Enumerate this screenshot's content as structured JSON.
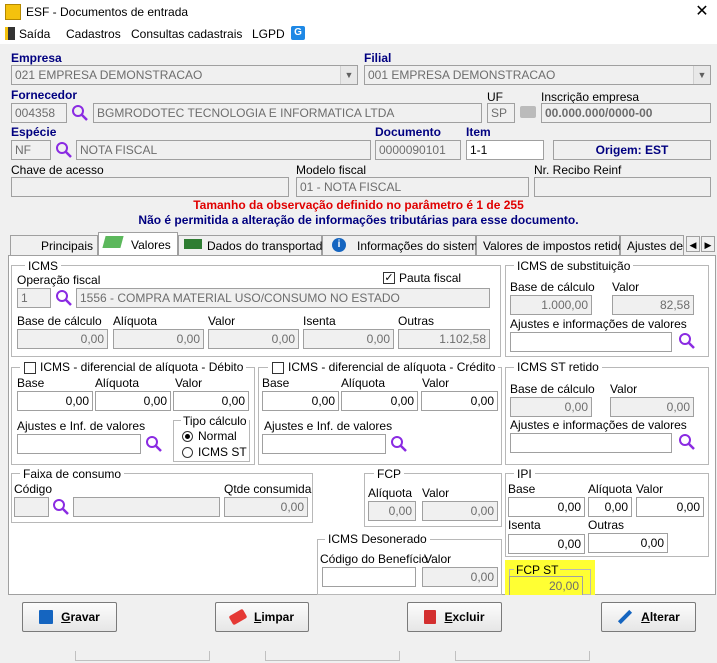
{
  "window": {
    "title": "ESF - Documentos de entrada",
    "close": "✕"
  },
  "menu": [
    "Saída",
    "Cadastros",
    "Consultas cadastrais",
    "LGPD"
  ],
  "header": {
    "empresa_label": "Empresa",
    "empresa_value": "021 EMPRESA DEMONSTRACAO",
    "filial_label": "Filial",
    "filial_value": "001 EMPRESA DEMONSTRACAO",
    "fornecedor_label": "Fornecedor",
    "fornecedor_code": "004358",
    "fornecedor_name": "BGMRODOTEC TECNOLOGIA E INFORMATICA LTDA",
    "uf_label": "UF",
    "uf_value": "SP",
    "inscricao_label": "Inscrição empresa",
    "inscricao_value": "00.000.000/0000-00",
    "especie_label": "Espécie",
    "especie_code": "NF",
    "especie_name": "NOTA FISCAL",
    "documento_label": "Documento",
    "documento_value": "0000090101",
    "item_label": "Item",
    "item_value": "1-1",
    "origem": "Origem: EST",
    "chave_label": "Chave de acesso",
    "chave_value": "",
    "modelo_label": "Modelo fiscal",
    "modelo_value": "01 - NOTA FISCAL",
    "recibo_label": "Nr. Recibo Reinf",
    "recibo_value": ""
  },
  "messages": {
    "red": "Tamanho da observação definido no parâmetro é 1 de 255",
    "blue": "Não é permitida a alteração de informações tributárias para esse documento."
  },
  "tabs": [
    "Principais",
    "Valores",
    "Dados do transportador",
    "Informações do sistema",
    "Valores de impostos retidos",
    "Ajustes de C"
  ],
  "icms": {
    "title": "ICMS",
    "operacao_label": "Operação fiscal",
    "operacao_code": "1",
    "operacao_desc": "1556 - COMPRA MATERIAL USO/CONSUMO NO ESTADO",
    "pauta_label": "Pauta fiscal",
    "pauta_checked": "✓",
    "base_label": "Base de cálculo",
    "aliquota_label": "Alíquota",
    "valor_label": "Valor",
    "isenta_label": "Isenta",
    "outras_label": "Outras",
    "base": "0,00",
    "aliquota": "0,00",
    "valor": "0,00",
    "isenta": "0,00",
    "outras": "1.102,58"
  },
  "icms_st": {
    "title": "ICMS de substituição",
    "base_label": "Base de cálculo",
    "valor_label": "Valor",
    "base": "1.000,00",
    "valor": "82,58",
    "ajustes_label": "Ajustes e informações de valores"
  },
  "difal_debito": {
    "title": "ICMS - diferencial de alíquota - Débito",
    "base_label": "Base",
    "aliquota_label": "Alíquota",
    "valor_label": "Valor",
    "base": "0,00",
    "aliquota": "0,00",
    "valor": "0,00",
    "ajustes_label": "Ajustes e Inf. de valores",
    "tipo_label": "Tipo cálculo",
    "opt_normal": "Normal",
    "opt_st": "ICMS ST"
  },
  "difal_credito": {
    "title": "ICMS - diferencial de alíquota - Crédito",
    "base_label": "Base",
    "aliquota_label": "Alíquota",
    "valor_label": "Valor",
    "base": "0,00",
    "aliquota": "0,00",
    "valor": "0,00",
    "ajustes_label": "Ajustes e Inf. de valores"
  },
  "icms_st_retido": {
    "title": "ICMS ST retido",
    "base_label": "Base de cálculo",
    "valor_label": "Valor",
    "base": "0,00",
    "valor": "0,00",
    "ajustes_label": "Ajustes e informações de valores"
  },
  "faixa": {
    "title": "Faixa de consumo",
    "codigo_label": "Código",
    "qtde_label": "Qtde consumida",
    "qtde": "0,00"
  },
  "fcp": {
    "title": "FCP",
    "aliquota_label": "Alíquota",
    "valor_label": "Valor",
    "aliquota": "0,00",
    "valor": "0,00"
  },
  "ipi": {
    "title": "IPI",
    "base_label": "Base",
    "aliquota_label": "Alíquota",
    "valor_label": "Valor",
    "isenta_label": "Isenta",
    "outras_label": "Outras",
    "base": "0,00",
    "aliquota": "0,00",
    "valor": "0,00",
    "isenta": "0,00",
    "outras": "0,00"
  },
  "desonerado": {
    "title": "ICMS Desonerado",
    "codigo_label": "Código do Benefício",
    "valor_label": "Valor",
    "valor": "0,00"
  },
  "fcp_st": {
    "title": "FCP ST",
    "value": "20,00"
  },
  "buttons": {
    "gravar_pre": "",
    "gravar_u": "G",
    "gravar_post": "ravar",
    "limpar_u": "L",
    "limpar_post": "impar",
    "excluir_u": "E",
    "excluir_post": "xcluir",
    "alterar_u": "A",
    "alterar_post": "lterar"
  },
  "colors": {
    "label_blue": "#000080",
    "message_red": "#e00000",
    "highlight": "#ffff33",
    "lgpd_icon": "#1e88e5"
  }
}
